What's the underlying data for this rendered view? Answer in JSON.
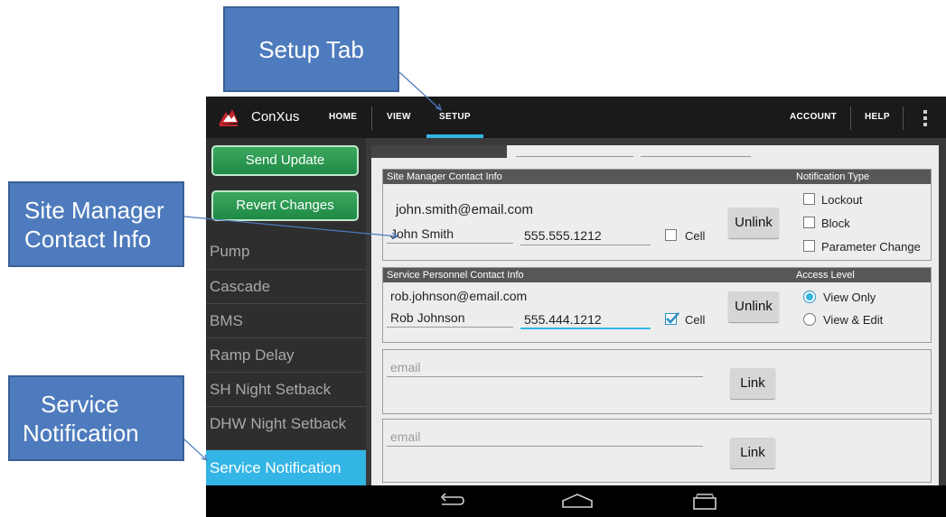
{
  "callouts": {
    "setup_tab": "Setup Tab",
    "site_manager_line1": "Site Manager",
    "site_manager_line2": "Contact Info",
    "service_line1": "Service",
    "service_line2": "Notification"
  },
  "app": {
    "title": "ConXus",
    "nav": [
      "HOME",
      "VIEW",
      "SETUP"
    ],
    "active_tab": "SETUP",
    "right_nav": [
      "ACCOUNT",
      "HELP"
    ],
    "accent": "#33b5e5"
  },
  "sidebar": {
    "send_update": "Send Update",
    "revert_changes": "Revert Changes",
    "items": [
      "Pump",
      "Cascade",
      "BMS",
      "Ramp Delay",
      "SH Night Setback",
      "DHW Night Setback",
      "Service Notification"
    ],
    "active_item": "Service Notification"
  },
  "site_manager": {
    "header": "Site Manager Contact Info",
    "type_header": "Notification Type",
    "email": "john.smith@email.com",
    "name": "John Smith",
    "phone": "555.555.1212",
    "cell_label": "Cell",
    "cell_checked": false,
    "unlink": "Unlink",
    "notification_types": [
      {
        "label": "Lockout",
        "checked": false
      },
      {
        "label": "Block",
        "checked": false
      },
      {
        "label": "Parameter Change",
        "checked": false
      }
    ]
  },
  "service_personnel": {
    "header": "Service Personnel Contact Info",
    "level_header": "Access Level",
    "email": "rob.johnson@email.com",
    "name": "Rob Johnson",
    "phone": "555.444.1212",
    "cell_label": "Cell",
    "cell_checked": true,
    "unlink": "Unlink",
    "access_levels": [
      {
        "label": "View Only",
        "selected": true
      },
      {
        "label": "View & Edit",
        "selected": false
      }
    ]
  },
  "empty_contacts": [
    {
      "email_placeholder": "email",
      "link": "Link"
    },
    {
      "email_placeholder": "email",
      "link": "Link"
    }
  ],
  "system_nav": [
    "back-icon",
    "home-icon",
    "recents-icon"
  ]
}
